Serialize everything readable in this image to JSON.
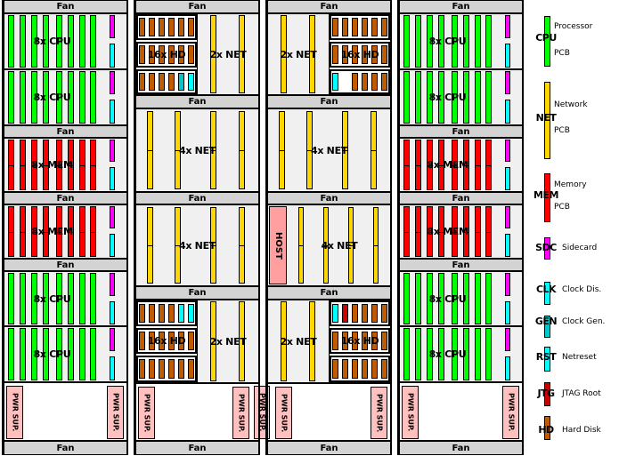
{
  "legend": [
    {
      "abbr": "CPU",
      "description": [
        "Processor",
        "PCB"
      ],
      "color": "#00ff00"
    },
    {
      "abbr": "NET",
      "description": [
        "Network",
        "PCB"
      ],
      "color": "#ffd700"
    },
    {
      "abbr": "MEM",
      "description": [
        "Memory",
        "PCB"
      ],
      "color": "#ff0000"
    },
    {
      "abbr": "SDC",
      "description": [
        "Sidecard"
      ],
      "color": "#ff00ff"
    },
    {
      "abbr": "CLK",
      "description": [
        "Clock Dis."
      ],
      "color": "#00ffff"
    },
    {
      "abbr": "GEN",
      "description": [
        "Clock Gen."
      ],
      "color": "#00c8c8"
    },
    {
      "abbr": "RST",
      "description": [
        "Netreset"
      ],
      "color": "#00ffff"
    },
    {
      "abbr": "JTG",
      "description": [
        "JTAG Root"
      ],
      "color": "#cc0000"
    },
    {
      "abbr": "HD",
      "description": [
        "Hard Disk"
      ],
      "color": "#c05c00"
    }
  ],
  "colors": {
    "fan": "#d3d3d3",
    "board": "#f0f0f0",
    "psu": "#ffc0c0",
    "host": "#ff9f9f"
  },
  "racks": [
    {
      "sections": [
        {
          "type": "fan",
          "label": "Fan"
        },
        {
          "type": "cpu",
          "label": "8x CPU",
          "slots": [
            "CPU",
            "CPU",
            "CPU",
            "CPU",
            "CPU",
            "CPU",
            "CPU",
            "CPU"
          ],
          "side": [
            "SDC",
            "CLK"
          ]
        },
        {
          "type": "cpu",
          "label": "8x CPU",
          "slots": [
            "CPU",
            "CPU",
            "CPU",
            "CPU",
            "CPU",
            "CPU",
            "CPU",
            "CPU"
          ],
          "side": [
            "SDC",
            "CLK"
          ]
        },
        {
          "type": "fan",
          "label": "Fan"
        },
        {
          "type": "mem",
          "label": "8x MEM",
          "slots": [
            "MEM",
            "MEM",
            "MEM",
            "MEM",
            "MEM",
            "MEM",
            "MEM",
            "MEM"
          ],
          "side": [
            "SDC",
            "CLK"
          ]
        },
        {
          "type": "fan",
          "label": "Fan"
        },
        {
          "type": "mem",
          "label": "8x MEM",
          "slots": [
            "MEM",
            "MEM",
            "MEM",
            "MEM",
            "MEM",
            "MEM",
            "MEM",
            "MEM"
          ],
          "side": [
            "SDC",
            "CLK"
          ]
        },
        {
          "type": "fan",
          "label": "Fan"
        },
        {
          "type": "cpu",
          "label": "8x CPU",
          "slots": [
            "CPU",
            "CPU",
            "CPU",
            "CPU",
            "CPU",
            "CPU",
            "CPU",
            "CPU"
          ],
          "side": [
            "SDC",
            "CLK"
          ]
        },
        {
          "type": "cpu",
          "label": "8x CPU",
          "slots": [
            "CPU",
            "CPU",
            "CPU",
            "CPU",
            "CPU",
            "CPU",
            "CPU",
            "CPU"
          ],
          "side": [
            "SDC",
            "CLK"
          ]
        },
        {
          "type": "psu",
          "units": [
            "PWR SUP.",
            "PWR SUP."
          ]
        },
        {
          "type": "fan",
          "label": "Fan"
        }
      ]
    },
    {
      "sections": [
        {
          "type": "fan",
          "label": "Fan"
        },
        {
          "type": "hdnet",
          "order": [
            "hd",
            "net"
          ],
          "hd_label": "16x HD",
          "net_label": "2x NET",
          "hd_boards": [
            [
              "HD",
              "HD",
              "HD",
              "HD",
              "HD",
              "HD"
            ],
            [
              "HD",
              "HD",
              "HD",
              "HD",
              "HD",
              "HD"
            ],
            [
              "HD",
              "HD",
              "HD",
              "HD",
              "GEN",
              "CLK"
            ]
          ],
          "net_slots": [
            "NET",
            "NET"
          ]
        },
        {
          "type": "fan",
          "label": "Fan"
        },
        {
          "type": "net4",
          "label": "4x NET",
          "slots": [
            "NET",
            "NET",
            "NET",
            "NET"
          ]
        },
        {
          "type": "fan",
          "label": "Fan"
        },
        {
          "type": "net4",
          "label": "4x NET",
          "slots": [
            "NET",
            "NET",
            "NET",
            "NET"
          ]
        },
        {
          "type": "fan",
          "label": "Fan"
        },
        {
          "type": "hdnet",
          "order": [
            "hd",
            "net"
          ],
          "hd_label": "16x HD",
          "net_label": "2x NET",
          "hd_boards": [
            [
              "HD",
              "HD",
              "HD",
              "HD",
              "CLK",
              "RST"
            ],
            [
              "HD",
              "HD",
              "HD",
              "HD",
              "HD",
              "HD"
            ],
            [
              "HD",
              "HD",
              "HD",
              "HD",
              "HD",
              "HD"
            ]
          ],
          "net_slots": [
            "NET",
            "NET"
          ]
        },
        {
          "type": "psu",
          "units": [
            "PWR SUP.",
            "PWR SUP."
          ]
        },
        {
          "type": "fan",
          "label": "Fan"
        }
      ]
    },
    {
      "sections": [
        {
          "type": "fan",
          "label": "Fan"
        },
        {
          "type": "hdnet",
          "order": [
            "net",
            "hd"
          ],
          "hd_label": "16x HD",
          "net_label": "2x NET",
          "hd_boards": [
            [
              "HD",
              "HD",
              "HD",
              "HD",
              "HD",
              "HD"
            ],
            [
              "HD",
              "HD",
              "HD",
              "HD",
              "HD",
              "HD"
            ],
            [
              "CLK",
              null,
              "HD",
              "HD",
              "HD",
              "HD"
            ]
          ],
          "net_slots": [
            "NET",
            "NET"
          ]
        },
        {
          "type": "fan",
          "label": "Fan"
        },
        {
          "type": "net4",
          "label": "4x NET",
          "slots": [
            "NET",
            "NET",
            "NET",
            "NET"
          ]
        },
        {
          "type": "fan",
          "label": "Fan"
        },
        {
          "type": "net4",
          "label": "4x NET",
          "host": "HOST",
          "slots": [
            "NET",
            "NET",
            "NET",
            "NET"
          ]
        },
        {
          "type": "fan",
          "label": "Fan"
        },
        {
          "type": "hdnet",
          "order": [
            "net",
            "hd"
          ],
          "hd_label": "16x HD",
          "net_label": "2x NET",
          "hd_boards": [
            [
              "CLK",
              "JTG",
              "HD",
              "HD",
              "HD",
              "HD"
            ],
            [
              "HD",
              "HD",
              "HD",
              "HD",
              "HD",
              "HD"
            ],
            [
              "HD",
              "HD",
              "HD",
              "HD",
              "HD",
              "HD"
            ]
          ],
          "net_slots": [
            "NET",
            "NET"
          ]
        },
        {
          "type": "psu",
          "units": [
            "PWR SUP.",
            "PWR SUP."
          ]
        },
        {
          "type": "fan",
          "label": "Fan"
        }
      ]
    },
    {
      "sections": [
        {
          "type": "fan",
          "label": "Fan"
        },
        {
          "type": "cpu",
          "label": "8x CPU",
          "slots": [
            "CPU",
            "CPU",
            "CPU",
            "CPU",
            "CPU",
            "CPU",
            "CPU",
            "CPU"
          ],
          "side": [
            "SDC",
            "CLK"
          ]
        },
        {
          "type": "cpu",
          "label": "8x CPU",
          "slots": [
            "CPU",
            "CPU",
            "CPU",
            "CPU",
            "CPU",
            "CPU",
            "CPU",
            "CPU"
          ],
          "side": [
            "SDC",
            "CLK"
          ]
        },
        {
          "type": "fan",
          "label": "Fan"
        },
        {
          "type": "mem",
          "label": "8x MEM",
          "slots": [
            "MEM",
            "MEM",
            "MEM",
            "MEM",
            "MEM",
            "MEM",
            "MEM",
            "MEM"
          ],
          "side": [
            "SDC",
            "CLK"
          ]
        },
        {
          "type": "fan",
          "label": "Fan"
        },
        {
          "type": "mem",
          "label": "8x MEM",
          "slots": [
            "MEM",
            "MEM",
            "MEM",
            "MEM",
            "MEM",
            "MEM",
            "MEM",
            "MEM"
          ],
          "side": [
            "SDC",
            "CLK"
          ]
        },
        {
          "type": "fan",
          "label": "Fan"
        },
        {
          "type": "cpu",
          "label": "8x CPU",
          "slots": [
            "CPU",
            "CPU",
            "CPU",
            "CPU",
            "CPU",
            "CPU",
            "CPU",
            "CPU"
          ],
          "side": [
            "SDC",
            "CLK"
          ]
        },
        {
          "type": "cpu",
          "label": "8x CPU",
          "slots": [
            "CPU",
            "CPU",
            "CPU",
            "CPU",
            "CPU",
            "CPU",
            "CPU",
            "CPU"
          ],
          "side": [
            "SDC",
            "CLK"
          ]
        },
        {
          "type": "psu",
          "units": [
            "PWR SUP.",
            "PWR SUP."
          ]
        },
        {
          "type": "fan",
          "label": "Fan"
        }
      ]
    }
  ],
  "shared_psu": {
    "label": "PWR SUP."
  }
}
